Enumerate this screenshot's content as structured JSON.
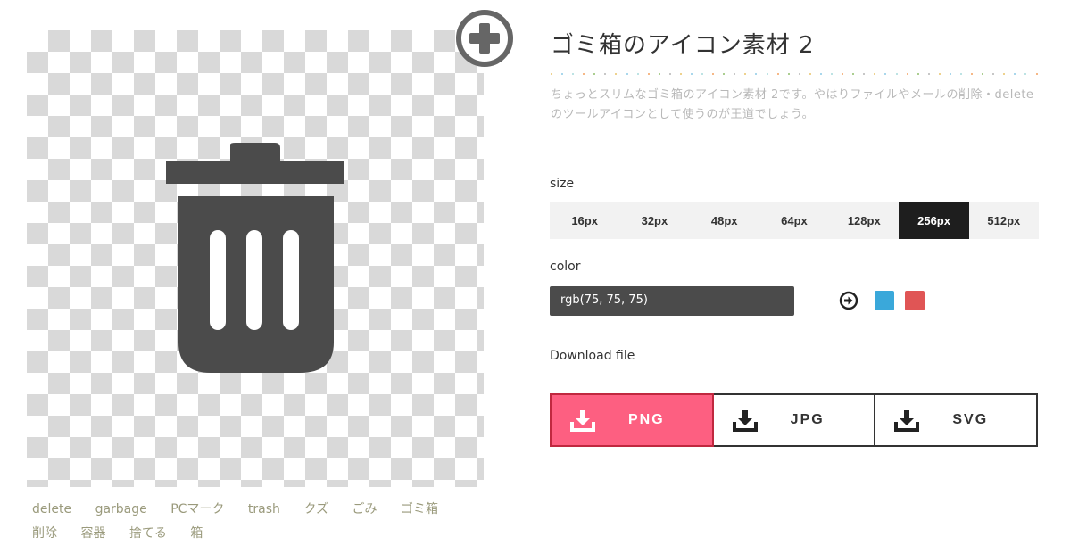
{
  "icon": {
    "title": "ゴミ箱のアイコン素材 2",
    "description": "ちょっとスリムなゴミ箱のアイコン素材 2です。やはりファイルやメールの削除・deleteのツールアイコンとして使うのが王道でしょう。",
    "fill_color": "#4b4b4b"
  },
  "tags": [
    "delete",
    "garbage",
    "PCマーク",
    "trash",
    "クズ",
    "ごみ",
    "ゴミ箱",
    "削除",
    "容器",
    "捨てる",
    "箱"
  ],
  "size_section": {
    "label": "size",
    "options": [
      "16px",
      "32px",
      "48px",
      "64px",
      "128px",
      "256px",
      "512px"
    ],
    "selected": "256px"
  },
  "color_section": {
    "label": "color",
    "value": "rgb(75, 75, 75)",
    "swatches": [
      "#3aa8da",
      "#e05555"
    ]
  },
  "download_section": {
    "label": "Download file",
    "formats": [
      "PNG",
      "JPG",
      "SVG"
    ],
    "selected": "PNG"
  },
  "colors": {
    "accent_pink": "#fd5f81",
    "dark": "#1e1e1e"
  },
  "icons": {
    "add": "plus-circle-icon",
    "color_next": "arrow-circle-icon",
    "download": "download-icon"
  }
}
